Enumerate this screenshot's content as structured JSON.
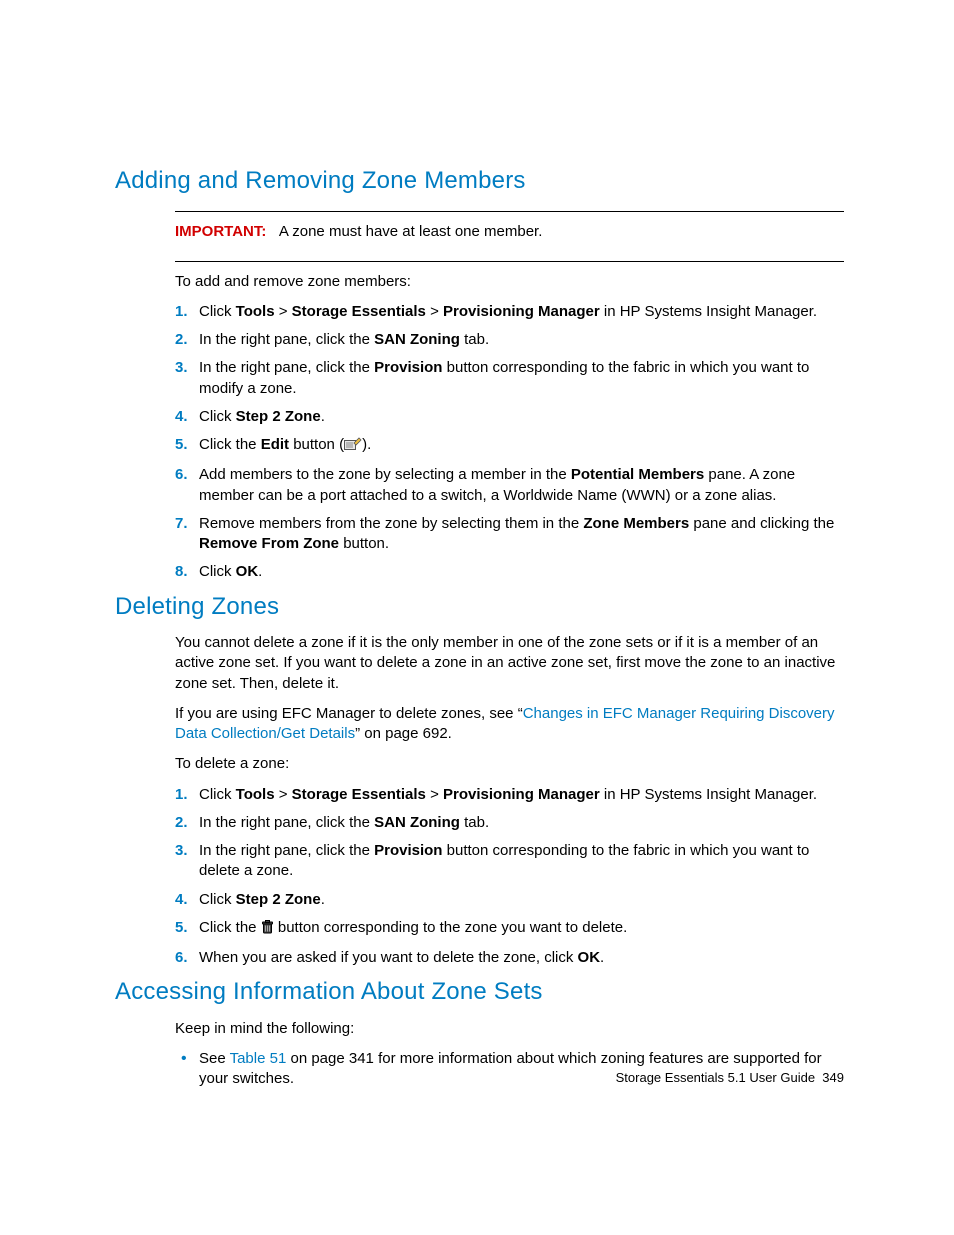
{
  "section1": {
    "title": "Adding and Removing Zone Members",
    "important_label": "IMPORTANT:",
    "important_text": "A zone must have at least one member.",
    "intro": "To add and remove zone members:",
    "steps": [
      {
        "n": "1.",
        "pre": "Click ",
        "b1": "Tools",
        "sep1": " > ",
        "b2": "Storage Essentials",
        "sep2": " > ",
        "b3": "Provisioning Manager",
        "post": " in HP Systems Insight Manager."
      },
      {
        "n": "2.",
        "pre": "In the right pane, click the ",
        "b1": "SAN Zoning",
        "post": " tab."
      },
      {
        "n": "3.",
        "pre": "In the right pane, click the ",
        "b1": "Provision",
        "post": " button corresponding to the fabric in which you want to modify a zone."
      },
      {
        "n": "4.",
        "pre": "Click ",
        "b1": "Step 2 Zone",
        "post": "."
      },
      {
        "n": "5.",
        "pre": "Click the ",
        "b1": "Edit",
        "mid": " button (",
        "post": ")."
      },
      {
        "n": "6.",
        "pre": "Add members to the zone by selecting a member in the ",
        "b1": "Potential Members",
        "post": " pane. A zone member can be a port attached to a switch, a Worldwide Name (WWN) or a zone alias."
      },
      {
        "n": "7.",
        "pre": "Remove members from the zone by selecting them in the ",
        "b1": "Zone Members",
        "mid": " pane and clicking the ",
        "b2": "Remove From Zone",
        "post": " button."
      },
      {
        "n": "8.",
        "pre": "Click ",
        "b1": "OK",
        "post": "."
      }
    ]
  },
  "section2": {
    "title": "Deleting Zones",
    "para1": "You cannot delete a zone if it is the only member in one of the zone sets or if it is a member of an active zone set. If you want to delete a zone in an active zone set, first move the zone to an inactive zone set. Then, delete it.",
    "para2_pre": "If you are using EFC Manager to delete zones, see “",
    "para2_link": "Changes in EFC Manager Requiring Discovery Data Collection/Get Details",
    "para2_post": "” on page 692.",
    "intro": "To delete a zone:",
    "steps": [
      {
        "n": "1.",
        "pre": "Click ",
        "b1": "Tools",
        "sep1": " > ",
        "b2": "Storage Essentials",
        "sep2": " > ",
        "b3": "Provisioning Manager",
        "post": " in HP Systems Insight Manager."
      },
      {
        "n": "2.",
        "pre": "In the right pane, click the ",
        "b1": "SAN Zoning",
        "post": " tab."
      },
      {
        "n": "3.",
        "pre": "In the right pane, click the ",
        "b1": "Provision",
        "post": " button corresponding to the fabric in which you want to delete a zone."
      },
      {
        "n": "4.",
        "pre": "Click ",
        "b1": "Step 2 Zone",
        "post": "."
      },
      {
        "n": "5.",
        "pre": "Click the ",
        "post": " button corresponding to the zone you want to delete."
      },
      {
        "n": "6.",
        "pre": "When you are asked if you want to delete the zone, click ",
        "b1": "OK",
        "post": "."
      }
    ]
  },
  "section3": {
    "title": "Accessing Information About Zone Sets",
    "intro": "Keep in mind the following:",
    "bullet_pre": "See ",
    "bullet_link": "Table 51",
    "bullet_post": " on page 341 for more information about which zoning features are supported for your switches."
  },
  "footer": {
    "text": "Storage Essentials 5.1 User Guide",
    "page": "349"
  }
}
